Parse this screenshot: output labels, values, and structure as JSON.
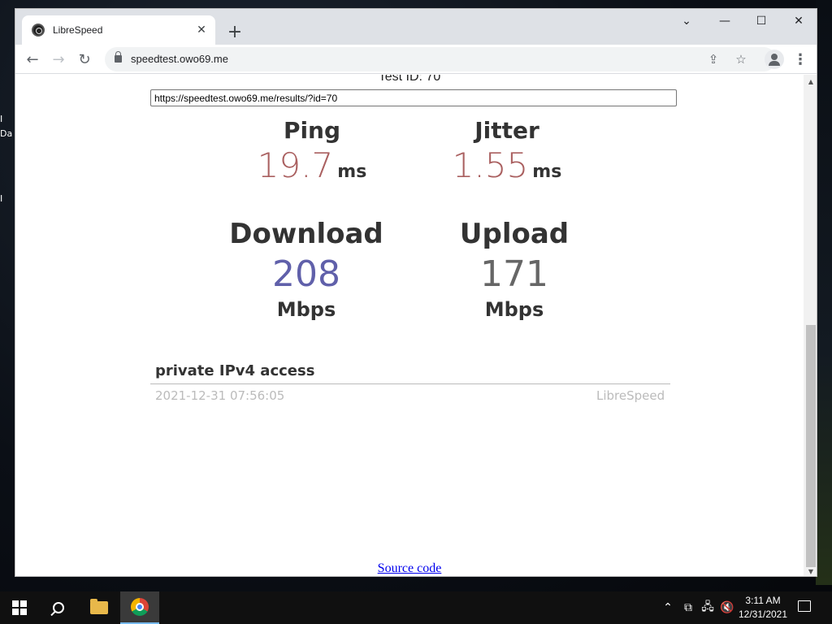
{
  "browser": {
    "tab_title": "LibreSpeed",
    "url": "speedtest.owo69.me"
  },
  "page": {
    "test_id_label": "Test ID: 70",
    "result_url": "https://speedtest.owo69.me/results/?id=70",
    "ping": {
      "label": "Ping",
      "value": "19.7",
      "unit": "ms"
    },
    "jitter": {
      "label": "Jitter",
      "value": "1.55",
      "unit": "ms"
    },
    "download": {
      "label": "Download",
      "value": "208",
      "unit": "Mbps"
    },
    "upload": {
      "label": "Upload",
      "value": "171",
      "unit": "Mbps"
    },
    "isp_info": "private IPv4 access",
    "timestamp": "2021-12-31 07:56:05",
    "brand": "LibreSpeed",
    "source_link": "Source code"
  },
  "taskbar": {
    "time": "3:11 AM",
    "date": "12/31/2021"
  },
  "colors": {
    "ping_value": "#aa6060",
    "speed_value": "#6060aa",
    "taskbar": "#101010"
  }
}
